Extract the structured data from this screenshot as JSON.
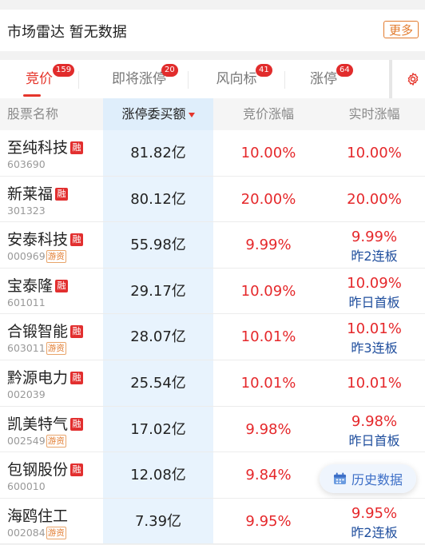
{
  "market": {
    "title": "市场雷达  暂无数据",
    "more": "更多"
  },
  "tabs": [
    {
      "label": "竞价",
      "badge": "159"
    },
    {
      "label": "即将涨停",
      "badge": "20"
    },
    {
      "label": "风向标",
      "badge": "41"
    },
    {
      "label": "涨停",
      "badge": "64"
    }
  ],
  "columns": {
    "name": "股票名称",
    "amount": "涨停委买额",
    "bid_change": "竞价涨幅",
    "realtime_change": "实时涨幅"
  },
  "rows": [
    {
      "name": "至纯科技",
      "code": "603690",
      "rong": "融",
      "tag": "",
      "amount": "81.82亿",
      "bid": "10.00%",
      "realtime": "10.00%",
      "sub": ""
    },
    {
      "name": "新莱福",
      "code": "301323",
      "rong": "融",
      "tag": "",
      "amount": "80.12亿",
      "bid": "20.00%",
      "realtime": "20.00%",
      "sub": ""
    },
    {
      "name": "安泰科技",
      "code": "000969",
      "rong": "融",
      "tag": "游资",
      "amount": "55.98亿",
      "bid": "9.99%",
      "realtime": "9.99%",
      "sub": "昨2连板"
    },
    {
      "name": "宝泰隆",
      "code": "601011",
      "rong": "融",
      "tag": "",
      "amount": "29.17亿",
      "bid": "10.09%",
      "realtime": "10.09%",
      "sub": "昨日首板"
    },
    {
      "name": "合锻智能",
      "code": "603011",
      "rong": "融",
      "tag": "游资",
      "amount": "28.07亿",
      "bid": "10.01%",
      "realtime": "10.01%",
      "sub": "昨3连板"
    },
    {
      "name": "黔源电力",
      "code": "002039",
      "rong": "融",
      "tag": "",
      "amount": "25.54亿",
      "bid": "10.01%",
      "realtime": "10.01%",
      "sub": ""
    },
    {
      "name": "凯美特气",
      "code": "002549",
      "rong": "融",
      "tag": "游资",
      "amount": "17.02亿",
      "bid": "9.98%",
      "realtime": "9.98%",
      "sub": "昨日首板"
    },
    {
      "name": "包钢股份",
      "code": "600010",
      "rong": "融",
      "tag": "",
      "amount": "12.08亿",
      "bid": "9.84%",
      "realtime": "",
      "sub": ""
    },
    {
      "name": "海鸥住工",
      "code": "002084",
      "rong": "",
      "tag": "游资",
      "amount": "7.39亿",
      "bid": "9.95%",
      "realtime": "9.95%",
      "sub": "昨2连板"
    }
  ],
  "history_button": "历史数据",
  "icons": {
    "settings": "gear-icon",
    "calendar": "calendar-icon"
  },
  "colors": {
    "up_red": "#e5282b",
    "accent_orange": "#e27b2e",
    "board_blue": "#1f4e9d"
  }
}
